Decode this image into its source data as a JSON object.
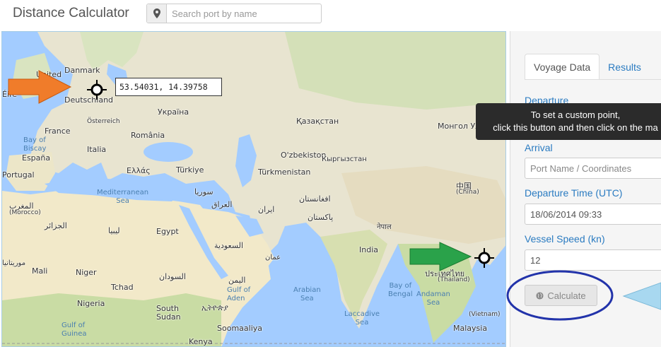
{
  "header": {
    "title": "Distance Calculator",
    "search_placeholder": "Search port by name"
  },
  "map": {
    "coordinates_readout": "53.54031, 14.39758",
    "labels": {
      "united_kingdom": "United",
      "eire": "Éire",
      "denmark": "Danmark",
      "deutschland": "Deutschland",
      "ukraine": "Україна",
      "kazakhstan": "Қазақстан",
      "mongolia": "Монгол Улс",
      "france": "France",
      "osterreich": "Österreich",
      "romania": "România",
      "italia": "Italia",
      "espana": "España",
      "portugal": "Portugal",
      "greece": "Ελλάς",
      "turkey": "Türkiye",
      "uzbekistan": "O'zbekiston",
      "kyrgyzstan": "Кыргызстан",
      "turkmenistan": "Türkmenistan",
      "china": "中国",
      "china_latin": "(China)",
      "bay_of_biscay": "Bay of\nBiscay",
      "mediterranean": "Mediterranean\nSea",
      "morocco": "المغرب",
      "morocco_latin": "(Morocco)",
      "algeria": "الجزائر",
      "libya": "ليبيا",
      "egypt": "Egypt",
      "syria": "سوريا",
      "iraq": "العراق",
      "iran": "ایران",
      "afghanistan": "افغانستان",
      "pakistan": "پاکستان",
      "nepal": "नेपाल",
      "saudi_arabia": "السعودية",
      "oman": "عمان",
      "yemen": "اليمن",
      "india": "India",
      "mali": "Mali",
      "niger": "Niger",
      "tchad": "Tchad",
      "sudan": "السودان",
      "mauritania": "موريتانيا",
      "nigeria": "Nigeria",
      "gulf_of_guinea": "Gulf of\nGuinea",
      "south_sudan": "South\nSudan",
      "ethiopia": "ኢትዮጵያ",
      "gulf_of_aden": "Gulf of\nAden",
      "arabian_sea": "Arabian\nSea",
      "bay_of_bengal": "Bay of\nBengal",
      "andaman": "Andaman\nSea",
      "thailand": "ประเทศไทย",
      "thailand_latin": "(Thailand)",
      "vietnam": "(Vietnam)",
      "laccadive": "Laccadive\nSea",
      "somalia": "Soomaaliya",
      "kenya": "Kenya",
      "malaysia": "Malaysia"
    },
    "colors": {
      "water": "#a3ccff",
      "land": "#e8e4d0",
      "green_land": "#c9dca4",
      "desert": "#f2e9c9"
    }
  },
  "panel": {
    "tabs": [
      {
        "label": "Voyage Data",
        "active": true
      },
      {
        "label": "Results",
        "active": false
      }
    ],
    "departure_label": "Departure",
    "arrival_label": "Arrival",
    "arrival_placeholder": "Port Name / Coordinates",
    "departure_time_label": "Departure Time (UTC)",
    "departure_time_value": "18/06/2014 09:33",
    "vessel_speed_label": "Vessel Speed (kn)",
    "vessel_speed_value": "12",
    "calculate_label": "Calculate",
    "tooltip_line1": "To set a custom point,",
    "tooltip_line2": "click this button and then click on the ma"
  },
  "annotations": {
    "orange_arrow_color": "#f07c2a",
    "green_arrow_color": "#2aa24a",
    "blue_arrow_color": "#a8d8f0",
    "ellipse_color": "#2233aa"
  }
}
